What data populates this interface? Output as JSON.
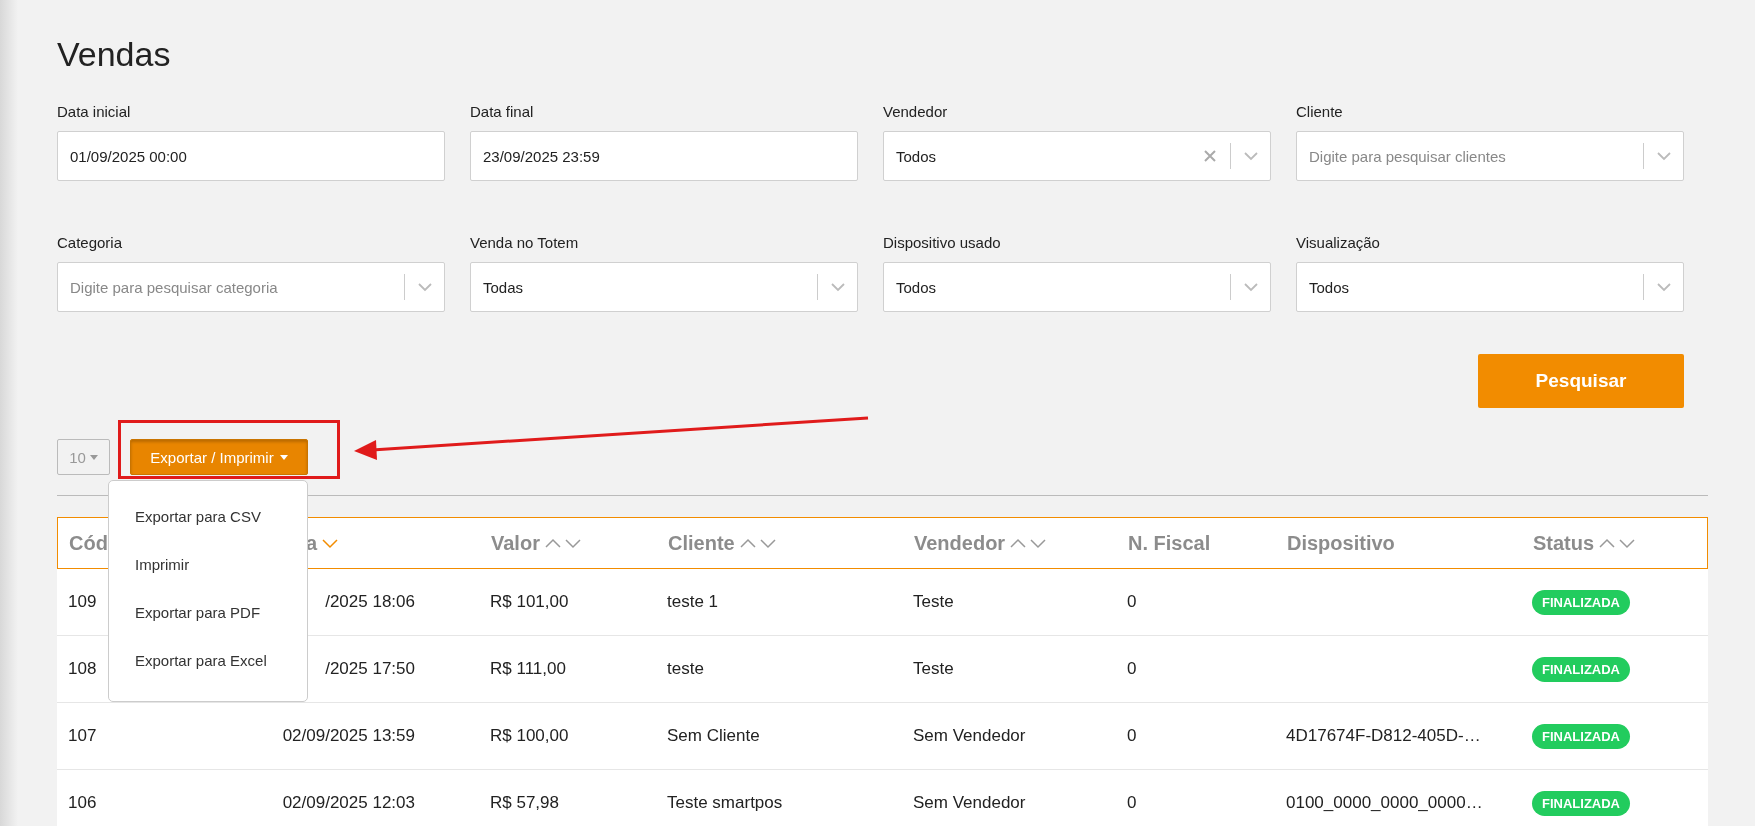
{
  "page": {
    "title": "Vendas"
  },
  "filters": [
    {
      "label": "Data inicial",
      "kind": "text",
      "value": "01/09/2025 00:00"
    },
    {
      "label": "Data final",
      "kind": "text",
      "value": "23/09/2025 23:59"
    },
    {
      "label": "Vendedor",
      "kind": "select",
      "value": "Todos",
      "clearable": true
    },
    {
      "label": "Cliente",
      "kind": "select",
      "placeholder": "Digite para pesquisar clientes",
      "clearable": false
    },
    {
      "label": "Categoria",
      "kind": "select",
      "placeholder": "Digite para pesquisar categoria",
      "clearable": false
    },
    {
      "label": "Venda no Totem",
      "kind": "select",
      "value": "Todas",
      "clearable": false
    },
    {
      "label": "Dispositivo usado",
      "kind": "select",
      "value": "Todos",
      "clearable": false
    },
    {
      "label": "Visualização",
      "kind": "select",
      "value": "Todos",
      "clearable": false
    }
  ],
  "search_button": "Pesquisar",
  "page_size": {
    "value": "10"
  },
  "export_button": {
    "label": "Exportar / Imprimir",
    "expanded": true
  },
  "export_menu": [
    "Exportar para CSV",
    "Imprimir",
    "Exportar para PDF",
    "Exportar para Excel"
  ],
  "table": {
    "columns": [
      {
        "label": "Cód",
        "sortable": false
      },
      {
        "label": "a",
        "sortable": true,
        "sorted": true
      },
      {
        "label": "Valor",
        "sortable": true,
        "sorted": false
      },
      {
        "label": "Cliente",
        "sortable": true,
        "sorted": false
      },
      {
        "label": "Vendedor",
        "sortable": true,
        "sorted": false
      },
      {
        "label": "N. Fiscal",
        "sortable": false,
        "sorted": false
      },
      {
        "label": "Dispositivo",
        "sortable": false,
        "sorted": false
      },
      {
        "label": "Status",
        "sortable": true,
        "sorted": false
      }
    ],
    "rows": [
      {
        "cells": [
          "109",
          "/2025 18:06",
          "R$ 101,00",
          "teste 1",
          "Teste",
          "0",
          ""
        ],
        "status": "FINALIZADA"
      },
      {
        "cells": [
          "108",
          "/2025 17:50",
          "R$ 111,00",
          "teste",
          "Teste",
          "0",
          ""
        ],
        "status": "FINALIZADA"
      },
      {
        "cells": [
          "107",
          "02/09/2025 13:59",
          "R$ 100,00",
          "Sem Cliente",
          "Sem Vendedor",
          "0",
          "4D17674F-D812-405D-…"
        ],
        "status": "FINALIZADA"
      },
      {
        "cells": [
          "106",
          "02/09/2025 12:03",
          "R$ 57,98",
          "Teste smartpos",
          "Sem Vendedor",
          "0",
          "0100_0000_0000_0000…"
        ],
        "status": "FINALIZADA"
      }
    ]
  },
  "annotations": {
    "highlight_box": true,
    "arrow": true
  }
}
